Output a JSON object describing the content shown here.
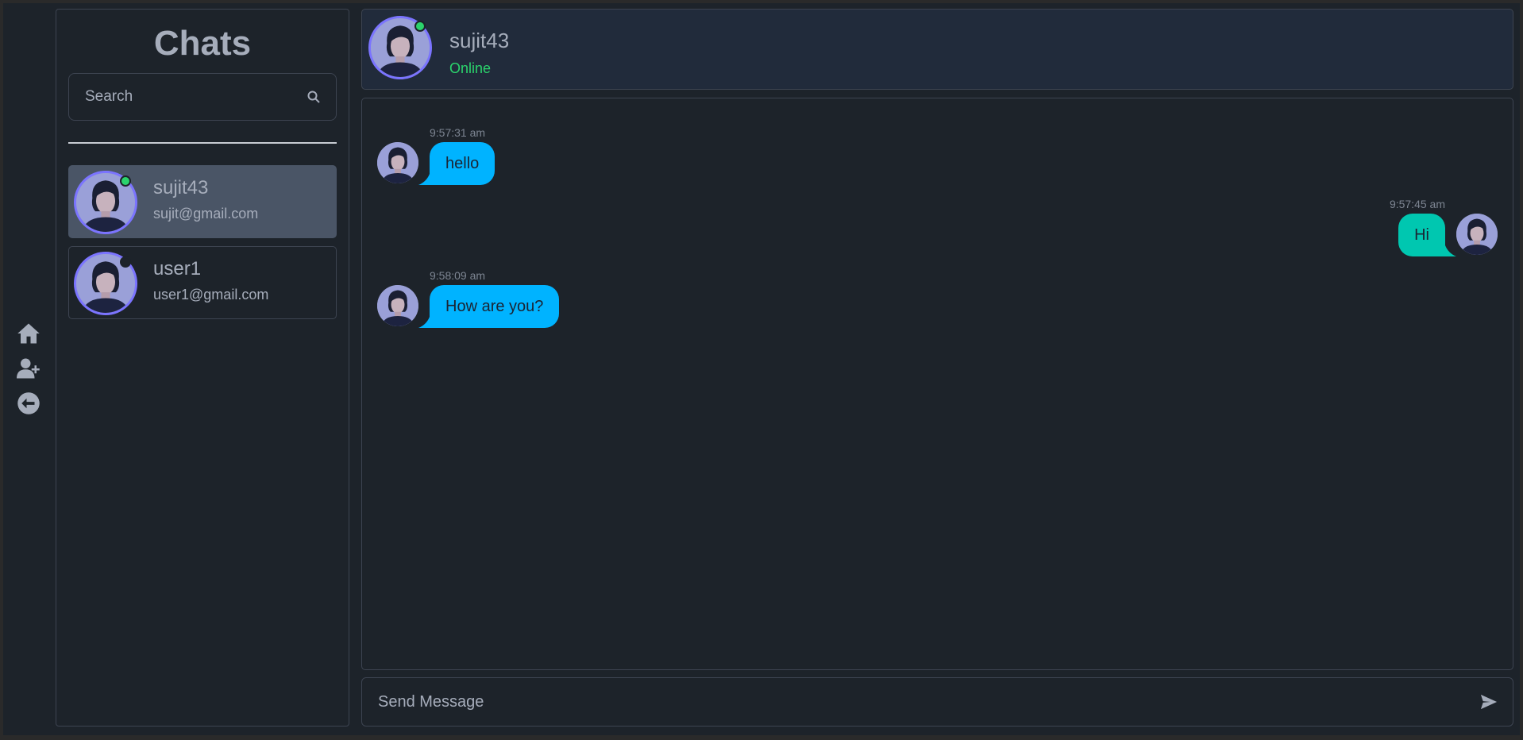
{
  "sidebar": {
    "title": "Chats",
    "search_placeholder": "Search",
    "chats": [
      {
        "name": "sujit43",
        "email": "sujit@gmail.com",
        "status": "online",
        "active": true
      },
      {
        "name": "user1",
        "email": "user1@gmail.com",
        "status": "offline",
        "active": false
      }
    ]
  },
  "nav": {
    "icons": [
      "home-icon",
      "add-user-icon",
      "logout-icon"
    ]
  },
  "conversation": {
    "name": "sujit43",
    "status": "Online",
    "messages": [
      {
        "time": "9:57:31 am",
        "text": "hello",
        "direction": "incoming"
      },
      {
        "time": "9:57:45 am",
        "text": "Hi",
        "direction": "outgoing"
      },
      {
        "time": "9:58:09 am",
        "text": "How are you?",
        "direction": "incoming"
      }
    ]
  },
  "composer": {
    "placeholder": "Send Message"
  },
  "colors": {
    "background": "#1d232a",
    "active_chat": "#4a5566",
    "incoming_bubble": "#00b3ff",
    "outgoing_bubble": "#00c7b0",
    "online": "#2bd36c",
    "avatar_ring": "#7b74ff"
  }
}
